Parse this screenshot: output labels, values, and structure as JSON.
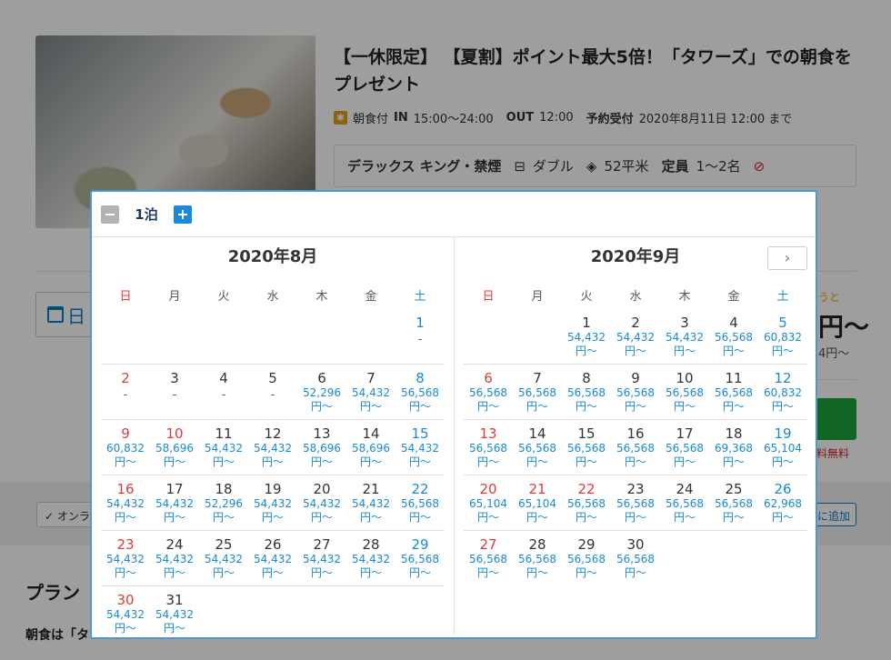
{
  "plan": {
    "title": "【一休限定】 【夏割】ポイント最大5倍！「タワーズ」での朝食をプレゼント",
    "meal": "朝食付",
    "in_label": "IN",
    "in_time": "15:00～24:00",
    "out_label": "OUT",
    "out_time": "12:00",
    "reserve_label": "予約受付",
    "reserve_value": "2020年8月11日 12:00 まで"
  },
  "room": {
    "name": "デラックス キング・禁煙",
    "bed": "ダブル",
    "size": "52平米",
    "capacity_label": "定員",
    "capacity": "1～2名"
  },
  "background": {
    "date_label": "日",
    "right_text1": "うと",
    "right_price": "円～",
    "right_text2": "4円～",
    "right_text3": "料無料",
    "online_chip": "✓ オンラ",
    "add_chip": "に追加",
    "plan_head": "プラン",
    "plan_body": "朝食は「タ"
  },
  "picker": {
    "nights": "1泊",
    "next_symbol": "›",
    "weekdays": [
      "日",
      "月",
      "火",
      "水",
      "木",
      "金",
      "土"
    ],
    "price_suffix": "円～",
    "months": [
      {
        "title": "2020年8月",
        "weeks": [
          [
            null,
            null,
            null,
            null,
            null,
            null,
            {
              "d": "1",
              "p": "-"
            }
          ],
          [
            {
              "d": "2",
              "p": "-"
            },
            {
              "d": "3",
              "p": "-"
            },
            {
              "d": "4",
              "p": "-"
            },
            {
              "d": "5",
              "p": "-"
            },
            {
              "d": "6",
              "p": "52,296"
            },
            {
              "d": "7",
              "p": "54,432"
            },
            {
              "d": "8",
              "p": "56,568"
            }
          ],
          [
            {
              "d": "9",
              "p": "60,832"
            },
            {
              "d": "10",
              "p": "58,696",
              "holiday": true
            },
            {
              "d": "11",
              "p": "54,432"
            },
            {
              "d": "12",
              "p": "54,432"
            },
            {
              "d": "13",
              "p": "58,696"
            },
            {
              "d": "14",
              "p": "58,696"
            },
            {
              "d": "15",
              "p": "54,432"
            }
          ],
          [
            {
              "d": "16",
              "p": "54,432"
            },
            {
              "d": "17",
              "p": "54,432"
            },
            {
              "d": "18",
              "p": "52,296"
            },
            {
              "d": "19",
              "p": "54,432"
            },
            {
              "d": "20",
              "p": "54,432"
            },
            {
              "d": "21",
              "p": "54,432"
            },
            {
              "d": "22",
              "p": "56,568"
            }
          ],
          [
            {
              "d": "23",
              "p": "54,432"
            },
            {
              "d": "24",
              "p": "54,432"
            },
            {
              "d": "25",
              "p": "54,432"
            },
            {
              "d": "26",
              "p": "54,432"
            },
            {
              "d": "27",
              "p": "54,432"
            },
            {
              "d": "28",
              "p": "54,432"
            },
            {
              "d": "29",
              "p": "56,568"
            }
          ],
          [
            {
              "d": "30",
              "p": "54,432"
            },
            {
              "d": "31",
              "p": "54,432"
            },
            null,
            null,
            null,
            null,
            null
          ]
        ]
      },
      {
        "title": "2020年9月",
        "weeks": [
          [
            null,
            null,
            {
              "d": "1",
              "p": "54,432"
            },
            {
              "d": "2",
              "p": "54,432"
            },
            {
              "d": "3",
              "p": "54,432"
            },
            {
              "d": "4",
              "p": "56,568"
            },
            {
              "d": "5",
              "p": "60,832"
            }
          ],
          [
            {
              "d": "6",
              "p": "56,568"
            },
            {
              "d": "7",
              "p": "56,568"
            },
            {
              "d": "8",
              "p": "56,568"
            },
            {
              "d": "9",
              "p": "56,568"
            },
            {
              "d": "10",
              "p": "56,568"
            },
            {
              "d": "11",
              "p": "56,568"
            },
            {
              "d": "12",
              "p": "60,832"
            }
          ],
          [
            {
              "d": "13",
              "p": "56,568"
            },
            {
              "d": "14",
              "p": "56,568"
            },
            {
              "d": "15",
              "p": "56,568"
            },
            {
              "d": "16",
              "p": "56,568"
            },
            {
              "d": "17",
              "p": "56,568"
            },
            {
              "d": "18",
              "p": "69,368"
            },
            {
              "d": "19",
              "p": "65,104"
            }
          ],
          [
            {
              "d": "20",
              "p": "65,104"
            },
            {
              "d": "21",
              "p": "65,104",
              "holiday": true
            },
            {
              "d": "22",
              "p": "56,568",
              "holiday": true
            },
            {
              "d": "23",
              "p": "56,568"
            },
            {
              "d": "24",
              "p": "56,568"
            },
            {
              "d": "25",
              "p": "56,568"
            },
            {
              "d": "26",
              "p": "62,968"
            }
          ],
          [
            {
              "d": "27",
              "p": "56,568"
            },
            {
              "d": "28",
              "p": "56,568"
            },
            {
              "d": "29",
              "p": "56,568"
            },
            {
              "d": "30",
              "p": "56,568"
            },
            null,
            null,
            null
          ]
        ]
      }
    ]
  }
}
